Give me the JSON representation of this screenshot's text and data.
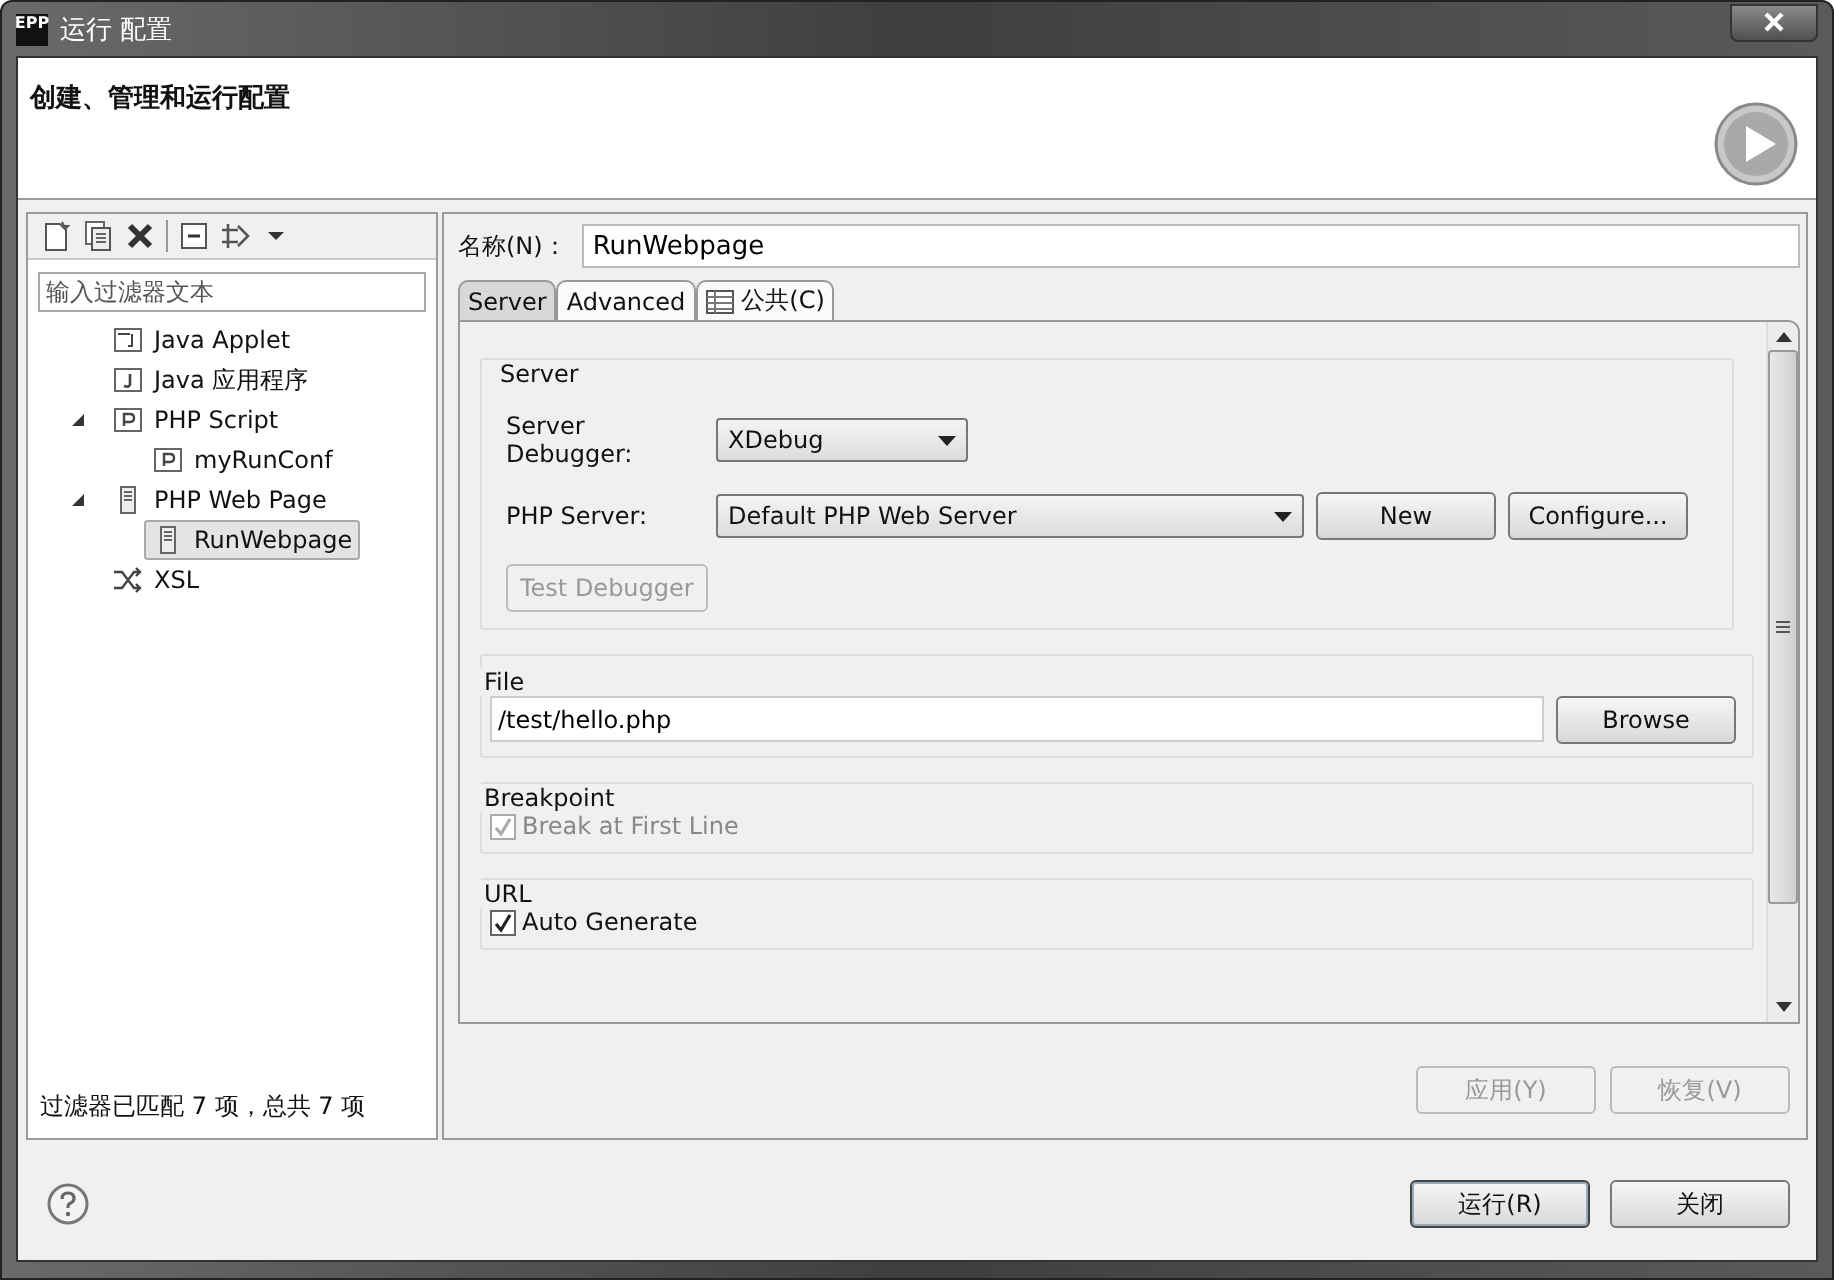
{
  "window": {
    "title": "运行 配置",
    "logo": "EPP"
  },
  "header": {
    "title": "创建、管理和运行配置"
  },
  "left_panel": {
    "filter": {
      "placeholder": "输入过滤器文本"
    },
    "tree": [
      {
        "label": "Java Applet",
        "kind": "applet",
        "selected": false
      },
      {
        "label": "Java 应用程序",
        "kind": "app",
        "selected": false
      },
      {
        "label": "PHP Script",
        "kind": "php",
        "selected": false,
        "expanded": true,
        "children": [
          {
            "label": "myRunConf",
            "kind": "php",
            "selected": false
          }
        ]
      },
      {
        "label": "PHP Web Page",
        "kind": "webpage",
        "selected": false,
        "expanded": true,
        "children": [
          {
            "label": "RunWebpage",
            "kind": "webpage",
            "selected": true
          }
        ]
      },
      {
        "label": "XSL",
        "kind": "xsl",
        "selected": false
      }
    ],
    "status": "过滤器已匹配 7 项，总共 7 项"
  },
  "right_panel": {
    "name_label": "名称(N)：",
    "name_value": "RunWebpage",
    "tabs": [
      {
        "label": "Server",
        "selected": true
      },
      {
        "label": "Advanced",
        "selected": false
      },
      {
        "label": "公共(C)",
        "selected": false,
        "icon": true
      }
    ],
    "server_group": {
      "title": "Server",
      "debugger_label": "Server\nDebugger:",
      "debugger_value": "XDebug",
      "server_label": "PHP Server:",
      "server_value": "Default PHP Web Server",
      "new_button": "New",
      "configure_button": "Configure...",
      "test_button": {
        "label": "Test Debugger",
        "disabled": true
      }
    },
    "file_group": {
      "title": "File",
      "value": "/test/hello.php",
      "browse_button": "Browse"
    },
    "breakpoint_group": {
      "title": "Breakpoint",
      "checkbox": {
        "label": "Break at First Line",
        "checked": true,
        "disabled": true
      }
    },
    "url_group": {
      "title": "URL",
      "checkbox": {
        "label": "Auto Generate",
        "checked": true,
        "disabled": false
      }
    },
    "buttons": [
      {
        "label": "应用(Y)",
        "disabled": true
      },
      {
        "label": "恢复(V)",
        "disabled": true
      }
    ]
  },
  "footer": {
    "buttons": [
      {
        "label": "运行(R)",
        "default": true
      },
      {
        "label": "关闭",
        "default": false
      }
    ]
  }
}
